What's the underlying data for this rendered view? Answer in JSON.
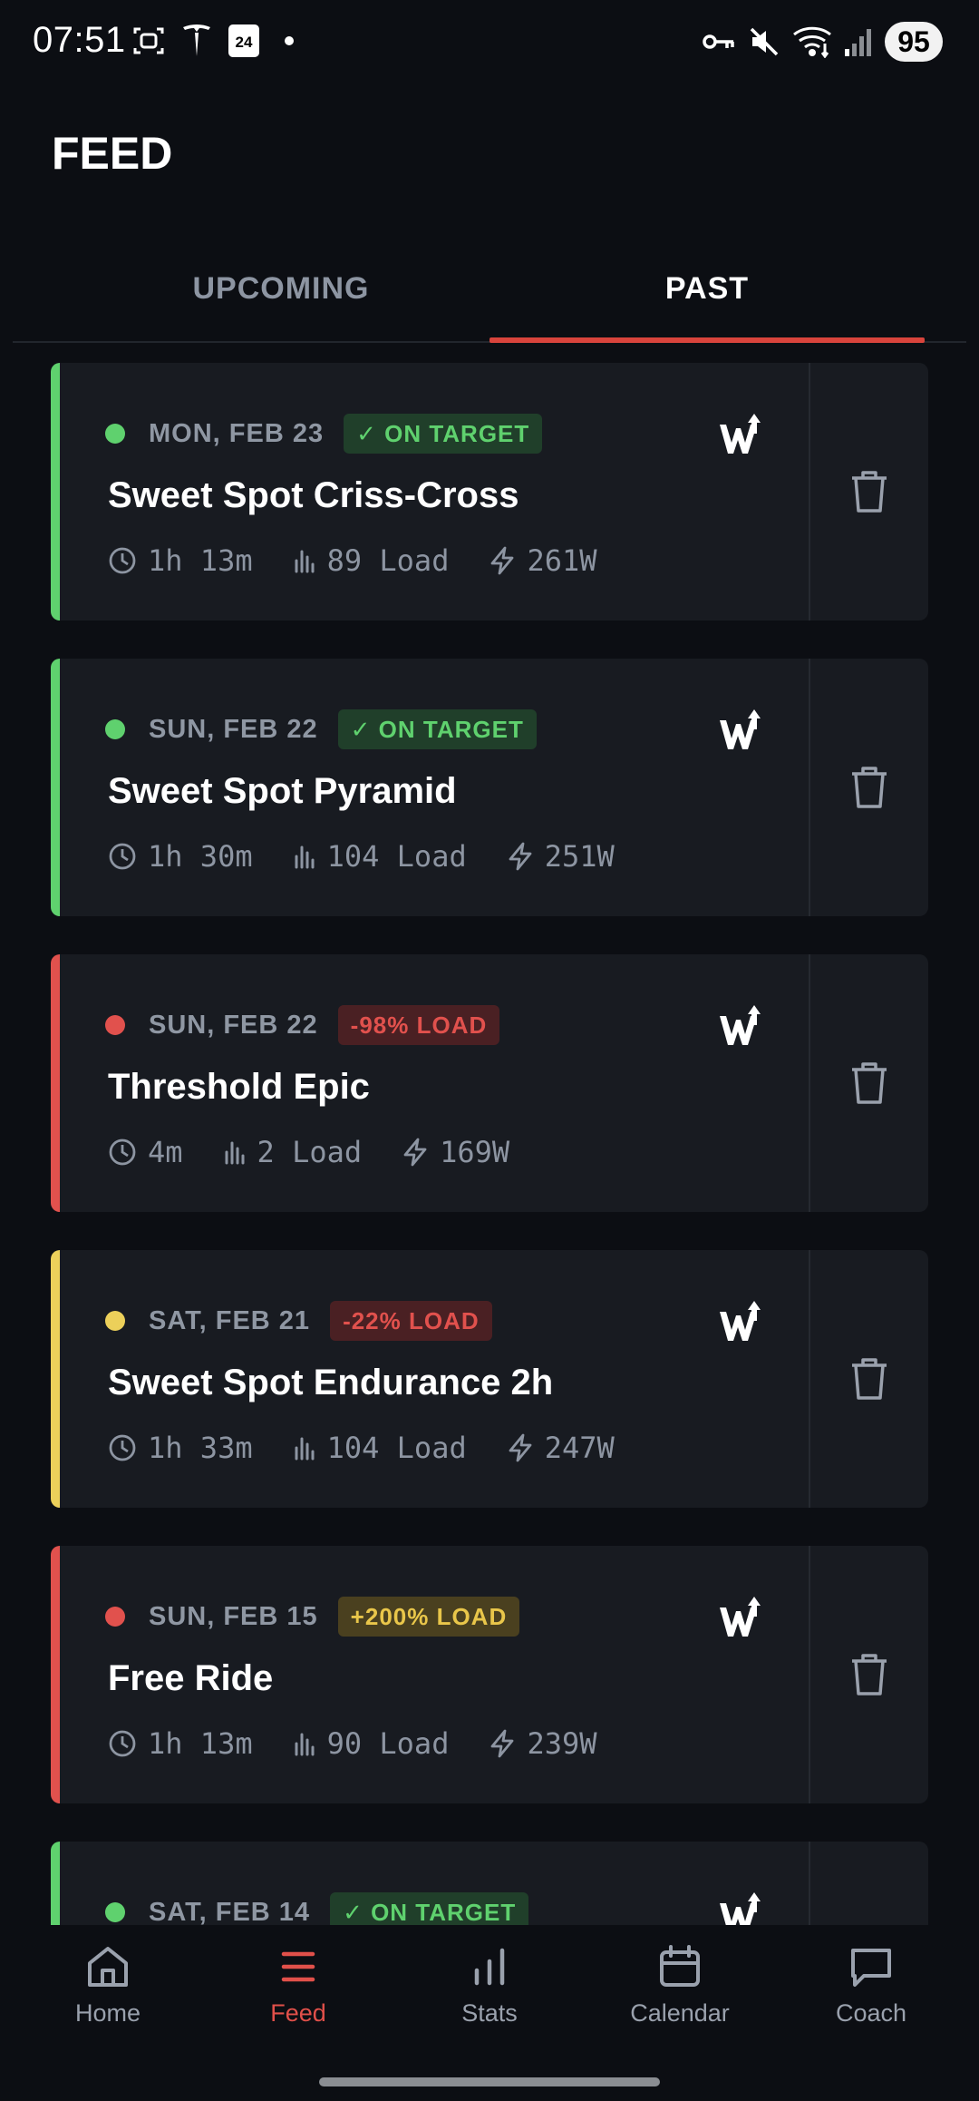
{
  "status_bar": {
    "time": "07:51",
    "calendar_day": "24",
    "battery": "95",
    "left_icons": [
      "face-scan-icon",
      "tesla-icon",
      "calendar-icon",
      "dot-icon"
    ],
    "right_icons": [
      "vpn-key-icon",
      "mute-icon",
      "wifi-icon",
      "signal-icon"
    ]
  },
  "header": {
    "title": "FEED"
  },
  "tabs": [
    {
      "label": "UPCOMING",
      "active": false
    },
    {
      "label": "PAST",
      "active": true
    }
  ],
  "colors": {
    "green": "#5fd16e",
    "red": "#e1514d",
    "yellow": "#ecd05a",
    "accent": "#d9443c"
  },
  "cards": [
    {
      "date": "MON, FEB 23",
      "badge": "✓ ON TARGET",
      "status": "green",
      "title": "Sweet Spot Criss-Cross",
      "duration": "1h 13m",
      "load": "89 Load",
      "power": "261W"
    },
    {
      "date": "SUN, FEB 22",
      "badge": "✓ ON TARGET",
      "status": "green",
      "title": "Sweet Spot Pyramid",
      "duration": "1h 30m",
      "load": "104 Load",
      "power": "251W"
    },
    {
      "date": "SUN, FEB 22",
      "badge": "-98% LOAD",
      "status": "red",
      "title": "Threshold Epic",
      "duration": "4m",
      "load": "2 Load",
      "power": "169W"
    },
    {
      "date": "SAT, FEB 21",
      "badge": "-22% LOAD",
      "status": "yellow",
      "badge_style": "red",
      "title": "Sweet Spot Endurance 2h",
      "duration": "1h 33m",
      "load": "104 Load",
      "power": "247W"
    },
    {
      "date": "SUN, FEB 15",
      "badge": "+200% LOAD",
      "status": "red",
      "badge_style": "yellow",
      "title": "Free Ride",
      "duration": "1h 13m",
      "load": "90 Load",
      "power": "239W"
    },
    {
      "date": "SAT, FEB 14",
      "badge": "✓ ON TARGET",
      "status": "green",
      "title": "",
      "duration": "",
      "load": "",
      "power": ""
    }
  ],
  "nav": [
    {
      "label": "Home",
      "icon": "home-icon",
      "active": false
    },
    {
      "label": "Feed",
      "icon": "feed-list-icon",
      "active": true
    },
    {
      "label": "Stats",
      "icon": "stats-bar-icon",
      "active": false
    },
    {
      "label": "Calendar",
      "icon": "calendar-icon",
      "active": false
    },
    {
      "label": "Coach",
      "icon": "chat-bubble-icon",
      "active": false
    }
  ]
}
